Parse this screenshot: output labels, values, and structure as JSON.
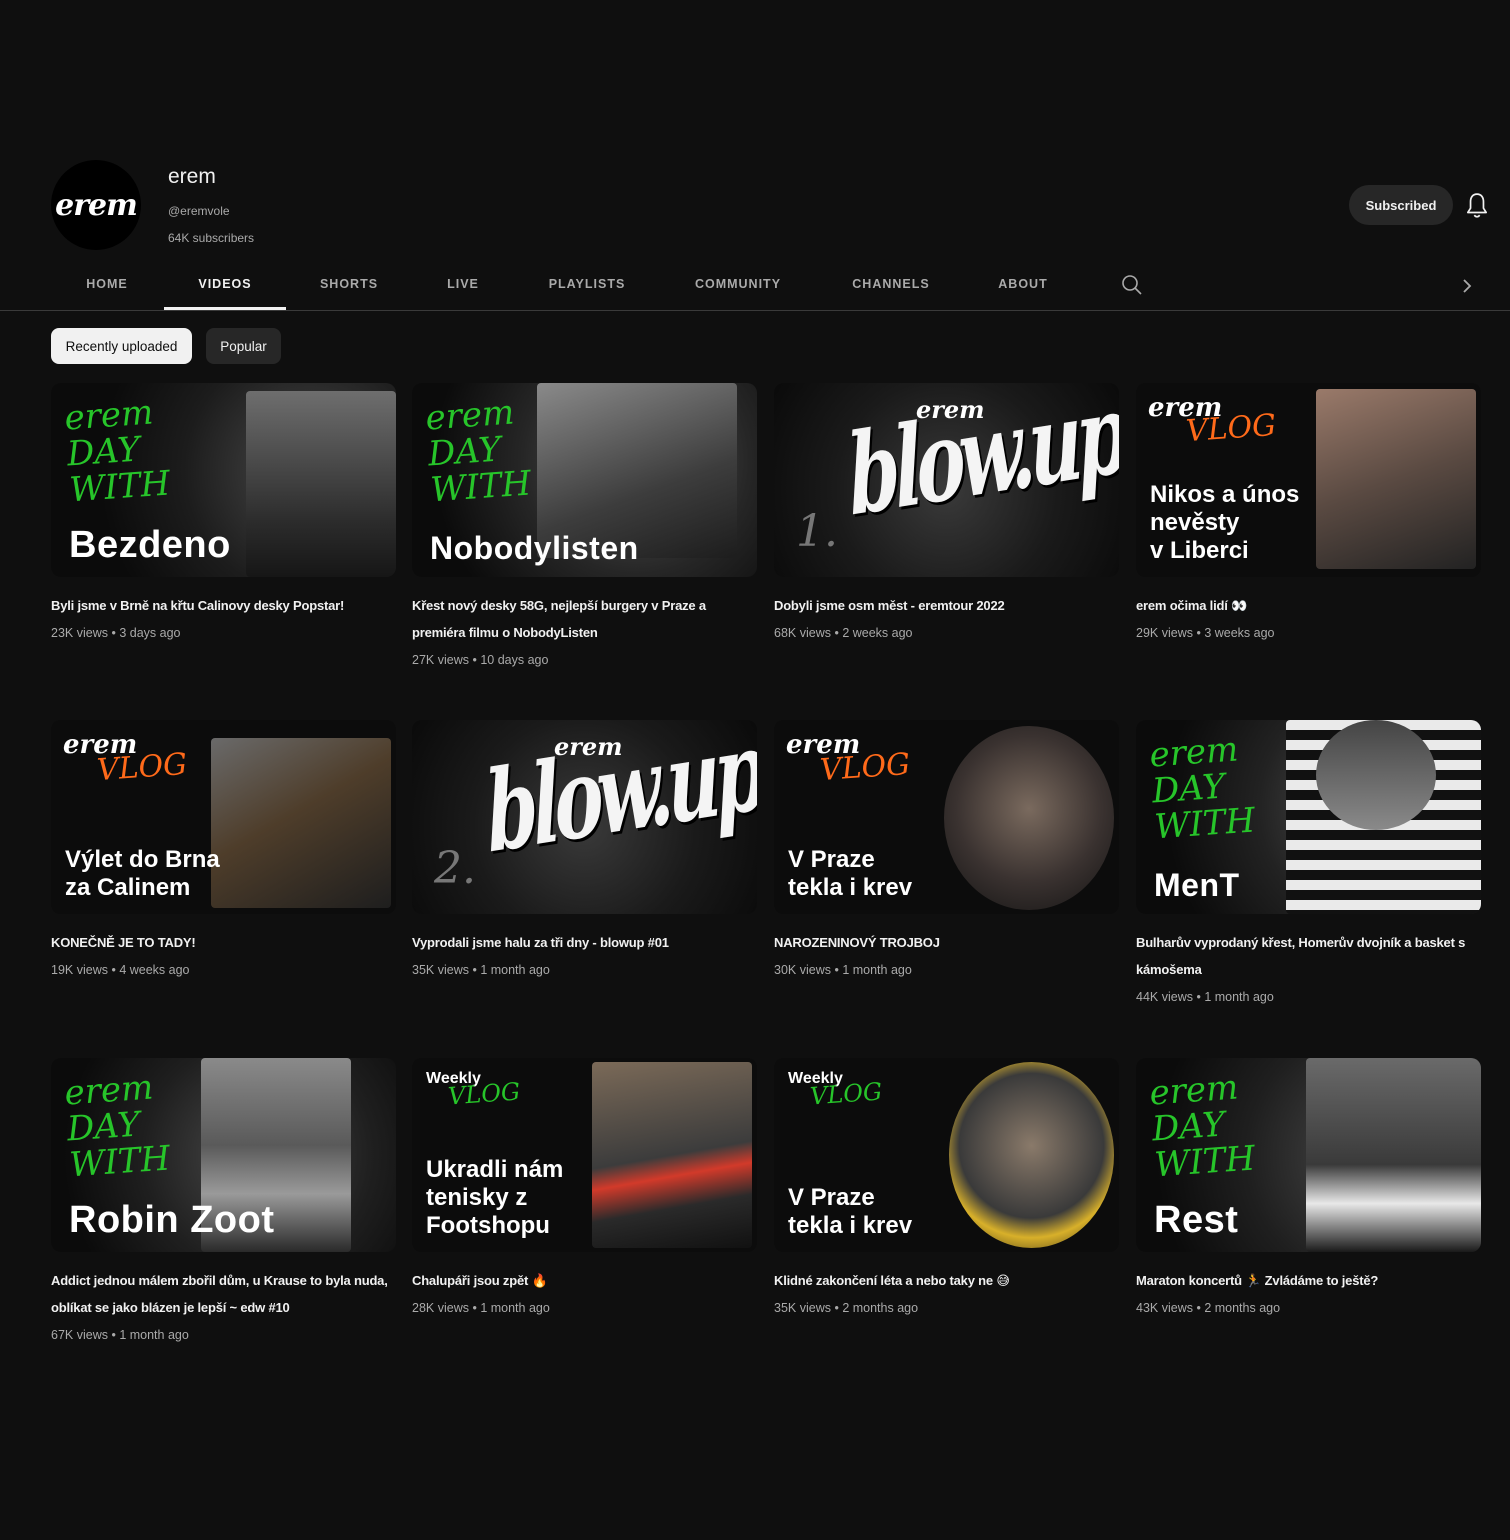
{
  "channel": {
    "avatar_text": "erem",
    "name": "erem",
    "handle": "@eremvole",
    "subscribers": "64K subscribers",
    "subscribe_label": "Subscribed"
  },
  "tabs": [
    {
      "label": "HOME"
    },
    {
      "label": "VIDEOS"
    },
    {
      "label": "SHORTS"
    },
    {
      "label": "LIVE"
    },
    {
      "label": "PLAYLISTS"
    },
    {
      "label": "COMMUNITY"
    },
    {
      "label": "CHANNELS"
    },
    {
      "label": "ABOUT"
    }
  ],
  "active_tab": "VIDEOS",
  "chips": {
    "recent": "Recently uploaded",
    "popular": "Popular",
    "selected": "Recently uploaded"
  },
  "colors": {
    "accent_green": "#27c52a",
    "accent_orange": "#ff6a1a",
    "background": "#0f0f0f"
  },
  "videos": [
    {
      "thumb_text": "Bezdeno",
      "title": "Byli jsme v Brně na křtu Calinovy desky Popstar!",
      "views": "23K views",
      "age": "3 days ago"
    },
    {
      "thumb_text": "Nobodylisten",
      "title": "Křest nový desky 58G, nejlepší burgery v Praze a premiéra filmu o NobodyListen",
      "views": "27K views",
      "age": "10 days ago"
    },
    {
      "thumb_text": "blow.up",
      "thumb_num": "1.",
      "title": "Dobyli jsme osm měst - eremtour 2022",
      "views": "68K views",
      "age": "2 weeks ago"
    },
    {
      "thumb_text": "Nikos a únos\nnevěsty\nv Liberci",
      "title": "erem očima lidí 👀",
      "views": "29K views",
      "age": "3 weeks ago"
    },
    {
      "thumb_text": "Výlet do Brna\nza Calinem",
      "title": "KONEČNĚ JE TO TADY!",
      "views": "19K views",
      "age": "4 weeks ago"
    },
    {
      "thumb_text": "blow.up",
      "thumb_num": "2.",
      "title": "Vyprodali jsme halu za tři dny - blowup #01",
      "views": "35K views",
      "age": "1 month ago"
    },
    {
      "thumb_text": "V Praze\ntekla i krev",
      "title": "NAROZENINOVÝ TROJBOJ",
      "views": "30K views",
      "age": "1 month ago"
    },
    {
      "thumb_text": "MenT",
      "title": "Bulharův vyprodaný křest, Homerův dvojník a basket s kámošema",
      "views": "44K views",
      "age": "1 month ago"
    },
    {
      "thumb_text": "Robin Zoot",
      "title": "Addict jednou málem zbořil dům, u Krause to byla nuda, oblíkat se jako blázen je lepší ~ edw #10",
      "views": "67K views",
      "age": "1 month ago"
    },
    {
      "thumb_text": "Ukradli nám\ntenisky z\nFootshopu",
      "thumb_small": "Weekly",
      "title": "Chalupáři jsou zpět 🔥",
      "views": "28K views",
      "age": "1 month ago"
    },
    {
      "thumb_text": "V Praze\ntekla i krev",
      "thumb_small": "Weekly",
      "title": "Klidné zakončení léta a nebo taky ne 😅",
      "views": "35K views",
      "age": "2 months ago"
    },
    {
      "thumb_text": "Rest",
      "title": "Maraton koncertů 🏃 Zvládáme to ještě?",
      "views": "43K views",
      "age": "2 months ago"
    }
  ],
  "thumb_labels": {
    "edw": "erem\nDAY\nWITH",
    "brand": "erem",
    "vlog": "VLOG"
  },
  "icons": [
    "bell-icon",
    "search-icon",
    "chevron-right-icon"
  ]
}
